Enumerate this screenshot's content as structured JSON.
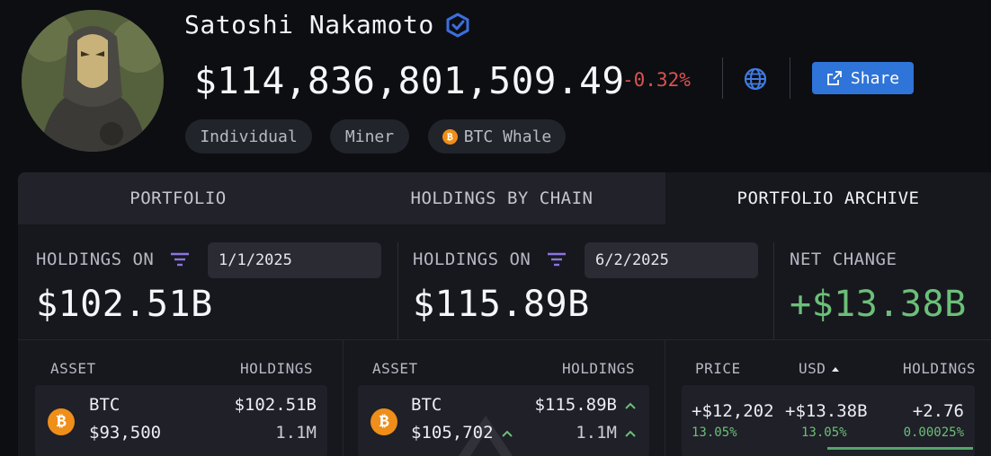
{
  "profile": {
    "name": "Satoshi Nakamoto",
    "total_value": "$114,836,801,509.49",
    "change_pct": "-0.32%",
    "share_label": "Share",
    "tags": [
      {
        "label": "Individual"
      },
      {
        "label": "Miner"
      },
      {
        "label": "BTC Whale",
        "icon": "bitcoin-icon"
      }
    ],
    "colors": {
      "negative": "#d9534f",
      "positive": "#6cbf79",
      "accent": "#2f74d8",
      "btc": "#ef8e19"
    }
  },
  "tabs": [
    {
      "label": "PORTFOLIO",
      "active": false
    },
    {
      "label": "HOLDINGS BY CHAIN",
      "active": false
    },
    {
      "label": "PORTFOLIO ARCHIVE",
      "active": true
    }
  ],
  "snapshots": [
    {
      "label": "HOLDINGS ON",
      "date": "1/1/2025",
      "value": "$102.51B"
    },
    {
      "label": "HOLDINGS ON",
      "date": "6/2/2025",
      "value": "$115.89B"
    }
  ],
  "net_change": {
    "label": "NET CHANGE",
    "value": "+$13.38B"
  },
  "tables": {
    "left": {
      "headers": {
        "asset": "ASSET",
        "holdings": "HOLDINGS"
      },
      "row": {
        "symbol": "BTC",
        "price": "$93,500",
        "value": "$102.51B",
        "amount": "1.1M"
      }
    },
    "right": {
      "headers": {
        "asset": "ASSET",
        "holdings": "HOLDINGS"
      },
      "row": {
        "symbol": "BTC",
        "price": "$105,702",
        "value": "$115.89B",
        "amount": "1.1M"
      }
    },
    "change": {
      "headers": {
        "price": "PRICE",
        "usd": "USD",
        "holdings": "HOLDINGS"
      },
      "row": {
        "price_change": "+$12,202",
        "price_pct": "13.05%",
        "usd_change": "+$13.38B",
        "usd_pct": "13.05%",
        "holdings_change": "+2.76",
        "holdings_pct": "0.00025%"
      }
    }
  }
}
